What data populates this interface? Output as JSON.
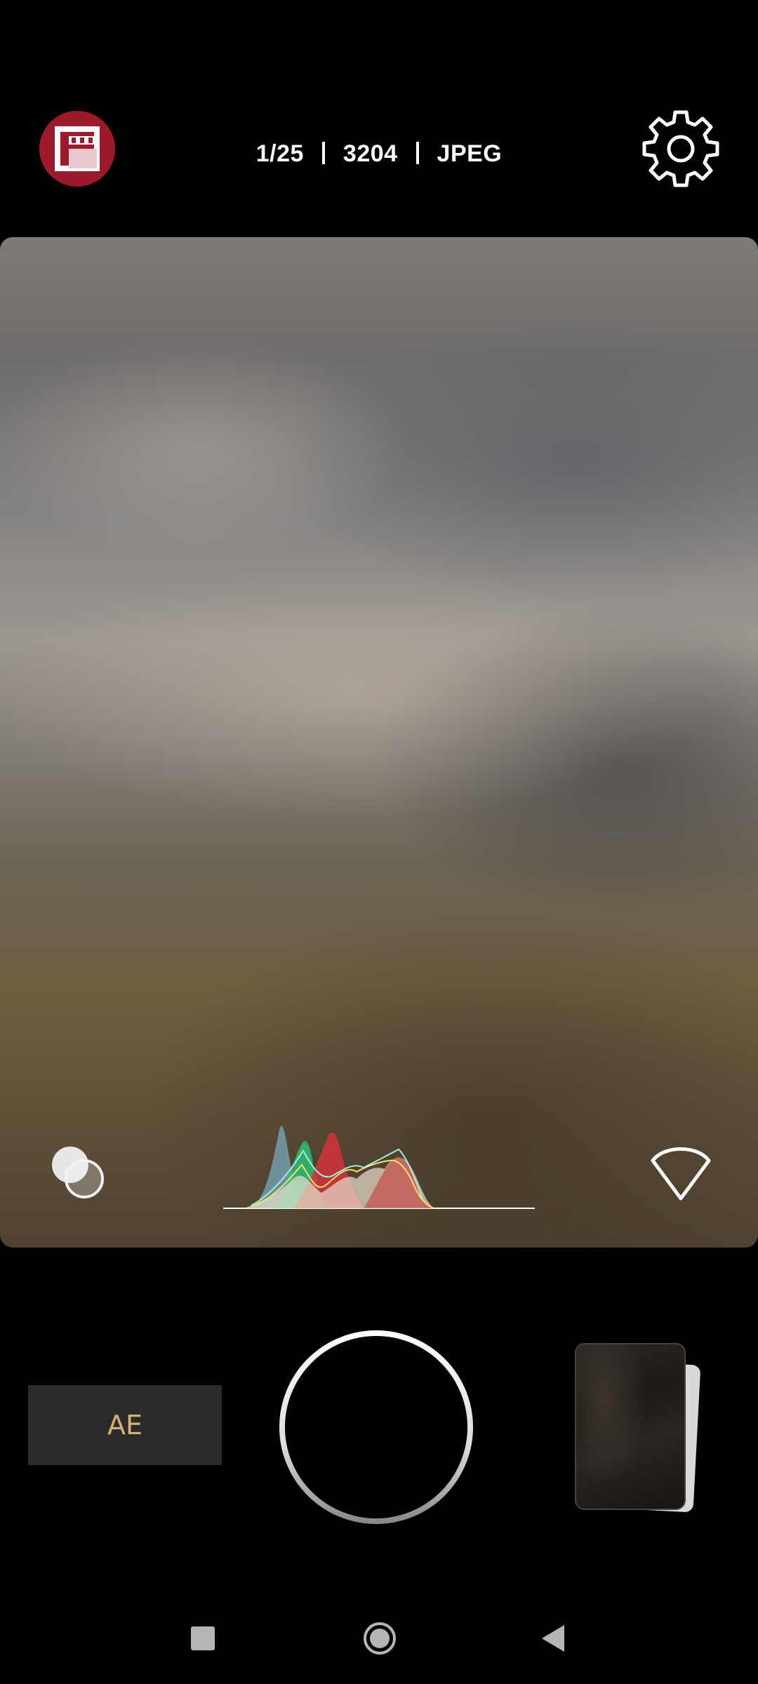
{
  "header": {
    "shutter_speed": "1/25",
    "iso": "3204",
    "file_format": "JPEG"
  },
  "icons": {
    "app_logo": "filmic-app-logo-icon",
    "settings": "gear-icon",
    "layers": "overlay-circles-icon",
    "focus": "focus-diamond-icon",
    "nav_recents": "square-icon",
    "nav_home": "circle-icon",
    "nav_back": "triangle-back-icon"
  },
  "controls": {
    "ae_label": "AE"
  },
  "colors": {
    "logo_red": "#9b1b2a",
    "ae_text": "#d8b070",
    "background": "#000000"
  }
}
